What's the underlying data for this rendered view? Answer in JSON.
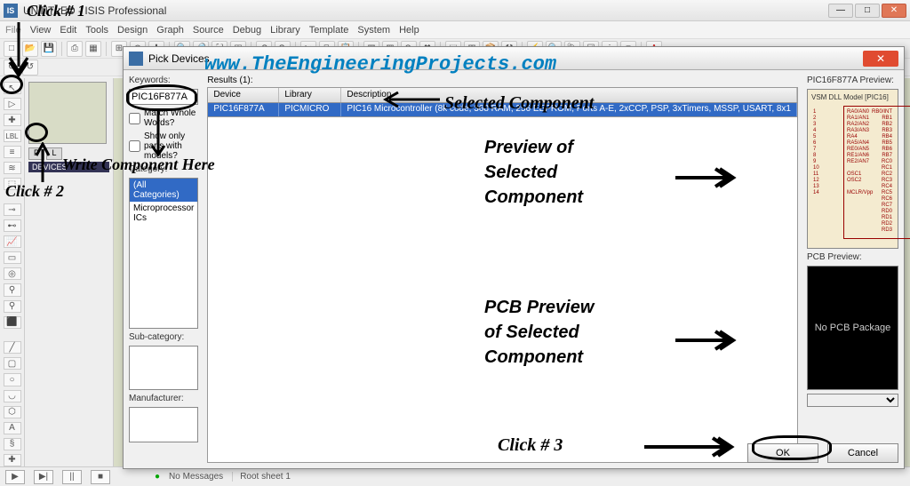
{
  "window": {
    "title": "UNTITLED - ISIS Professional"
  },
  "menu": [
    "File",
    "View",
    "Edit",
    "Tools",
    "Design",
    "Graph",
    "Source",
    "Debug",
    "Library",
    "Template",
    "System",
    "Help"
  ],
  "sidebar": {
    "p_label": "P",
    "l_label": "L",
    "devices_label": "DEVICES"
  },
  "statusbar": {
    "messages": "No Messages",
    "sheet": "Root sheet 1"
  },
  "dialog": {
    "title": "Pick Devices",
    "keywords_label": "Keywords:",
    "keywords_value": "PIC16F877A",
    "match_whole": "Match Whole Words?",
    "show_only": "Show only parts with models?",
    "category_label": "Category:",
    "categories": [
      "(All Categories)",
      "Microprocessor ICs"
    ],
    "subcategory_label": "Sub-category:",
    "manufacturer_label": "Manufacturer:",
    "results_label": "Results (1):",
    "columns": [
      "Device",
      "Library",
      "Description"
    ],
    "row": {
      "device": "PIC16F877A",
      "library": "PICMICRO",
      "description": "PIC16 Microcontroller (8k code, 368 RAM, 256 EEPROM, Ports A-E, 2xCCP, PSP, 3xTimers, MSSP, USART, 8x1"
    },
    "preview_label": "PIC16F877A Preview:",
    "model_label": "VSM DLL Model [PIC16]",
    "pcb_label": "PCB Preview:",
    "no_pcb": "No PCB Package",
    "ok": "OK",
    "cancel": "Cancel"
  },
  "annotations": {
    "click1": "Click # 1",
    "click2": "Click # 2",
    "write_here": "Write Component Here",
    "selected": "Selected Component",
    "preview_of": "Preview of",
    "selected2": "Selected",
    "component2": "Component",
    "pcb_prev": "PCB Preview",
    "of_sel": "of Selected",
    "comp3": "Component",
    "click3": "Click # 3",
    "watermark": "www.TheEngineeringProjects.com"
  }
}
